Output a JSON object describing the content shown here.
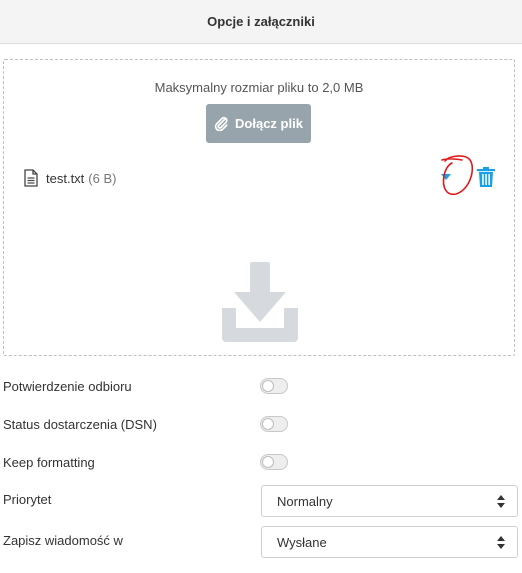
{
  "header": {
    "title": "Opcje i załączniki"
  },
  "dropzone": {
    "max_size_text": "Maksymalny rozmiar pliku to 2,0 MB",
    "attach_button_label": "Dołącz plik",
    "attachment": {
      "name": "test.txt",
      "size": "(6 B)"
    }
  },
  "options": {
    "read_receipt": {
      "label": "Potwierdzenie odbioru",
      "enabled": false
    },
    "dsn": {
      "label": "Status dostarczenia (DSN)",
      "enabled": false
    },
    "keep_formatting": {
      "label": "Keep formatting",
      "enabled": false
    },
    "priority": {
      "label": "Priorytet",
      "value": "Normalny"
    },
    "save_in": {
      "label": "Zapisz wiadomość w",
      "value": "Wysłane"
    }
  },
  "colors": {
    "accent": "#1aa0e6",
    "button_bg": "#98a4ac",
    "annotation": "#e01818"
  }
}
